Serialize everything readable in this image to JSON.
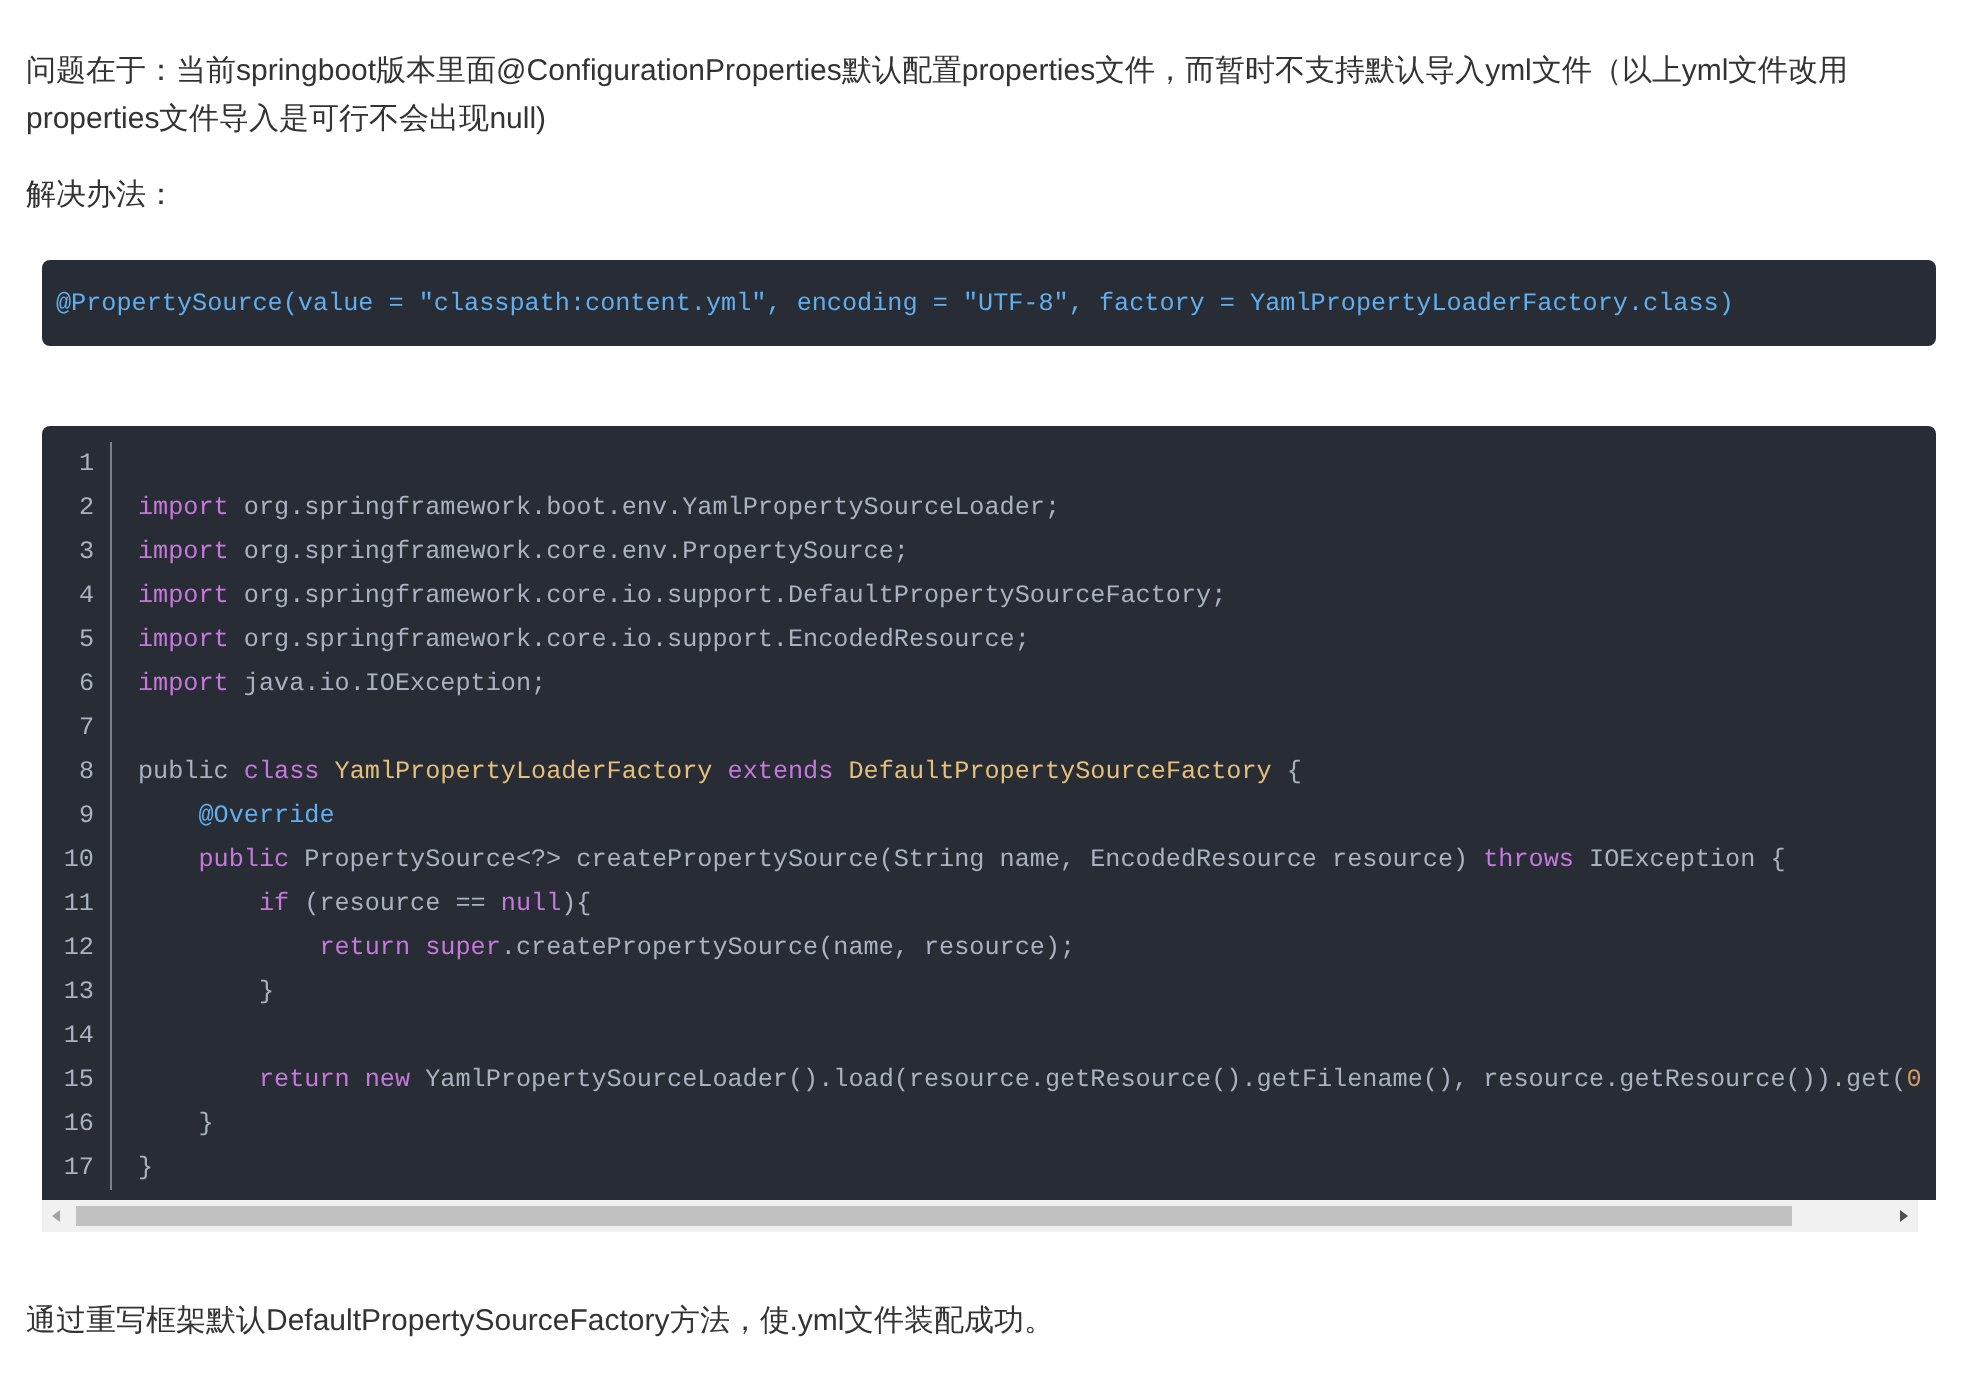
{
  "paragraphs_top": [
    "问题在于：当前springboot版本里面@ConfigurationProperties默认配置properties文件，而暂时不支持默认导入yml文件（以上yml文件改用properties文件导入是可行不会出现null)",
    "解决办法："
  ],
  "snippet": "@PropertySource(value = \"classpath:content.yml\", encoding = \"UTF-8\", factory = YamlPropertyLoaderFactory.class)",
  "code": {
    "lines": [
      {
        "number": "1"
      },
      {
        "number": "2",
        "tokens": [
          {
            "kind": "kw",
            "text": "import"
          },
          {
            "kind": "txt",
            "text": " org.springframework.boot.env.YamlPropertySourceLoader;"
          }
        ]
      },
      {
        "number": "3",
        "tokens": [
          {
            "kind": "kw",
            "text": "import"
          },
          {
            "kind": "txt",
            "text": " org.springframework.core.env.PropertySource;"
          }
        ]
      },
      {
        "number": "4",
        "tokens": [
          {
            "kind": "kw",
            "text": "import"
          },
          {
            "kind": "txt",
            "text": " org.springframework.core.io.support.DefaultPropertySourceFactory;"
          }
        ]
      },
      {
        "number": "5",
        "tokens": [
          {
            "kind": "kw",
            "text": "import"
          },
          {
            "kind": "txt",
            "text": " org.springframework.core.io.support.EncodedResource;"
          }
        ]
      },
      {
        "number": "6",
        "tokens": [
          {
            "kind": "kw",
            "text": "import"
          },
          {
            "kind": "txt",
            "text": " java.io.IOException;"
          }
        ]
      },
      {
        "number": "7"
      },
      {
        "number": "8",
        "tokens": [
          {
            "kind": "txt",
            "text": "public "
          },
          {
            "kind": "kw",
            "text": "class "
          },
          {
            "kind": "cls",
            "text": "YamlPropertyLoaderFactory "
          },
          {
            "kind": "kw",
            "text": "extends "
          },
          {
            "kind": "cls",
            "text": "DefaultPropertySourceFactory"
          },
          {
            "kind": "txt",
            "text": " {"
          }
        ]
      },
      {
        "number": "9",
        "tokens": [
          {
            "kind": "ann",
            "text": "    @Override"
          }
        ]
      },
      {
        "number": "10",
        "tokens": [
          {
            "kind": "kw",
            "text": "    public"
          },
          {
            "kind": "txt",
            "text": " PropertySource<?> createPropertySource(String name, EncodedResource resource) "
          },
          {
            "kind": "kw",
            "text": "throws"
          },
          {
            "kind": "txt",
            "text": " IOException {"
          }
        ]
      },
      {
        "number": "11",
        "tokens": [
          {
            "kind": "kw",
            "text": "        if"
          },
          {
            "kind": "txt",
            "text": " (resource == "
          },
          {
            "kind": "kw",
            "text": "null"
          },
          {
            "kind": "txt",
            "text": "){"
          }
        ]
      },
      {
        "number": "12",
        "tokens": [
          {
            "kind": "kw",
            "text": "            return super"
          },
          {
            "kind": "txt",
            "text": ".createPropertySource(name, resource);"
          }
        ]
      },
      {
        "number": "13",
        "tokens": [
          {
            "kind": "txt",
            "text": "        }"
          }
        ]
      },
      {
        "number": "14"
      },
      {
        "number": "15",
        "tokens": [
          {
            "kind": "kw",
            "text": "        return new"
          },
          {
            "kind": "txt",
            "text": " YamlPropertySourceLoader().load(resource.getResource().getFilename(), resource.getResource()).get("
          },
          {
            "kind": "num",
            "text": "0"
          }
        ]
      },
      {
        "number": "16",
        "tokens": [
          {
            "kind": "txt",
            "text": "    }"
          }
        ]
      },
      {
        "number": "17",
        "tokens": [
          {
            "kind": "txt",
            "text": "}"
          }
        ]
      }
    ]
  },
  "paragraph_bottom": "通过重写框架默认DefaultPropertySourceFactory方法，使.yml文件装配成功。"
}
